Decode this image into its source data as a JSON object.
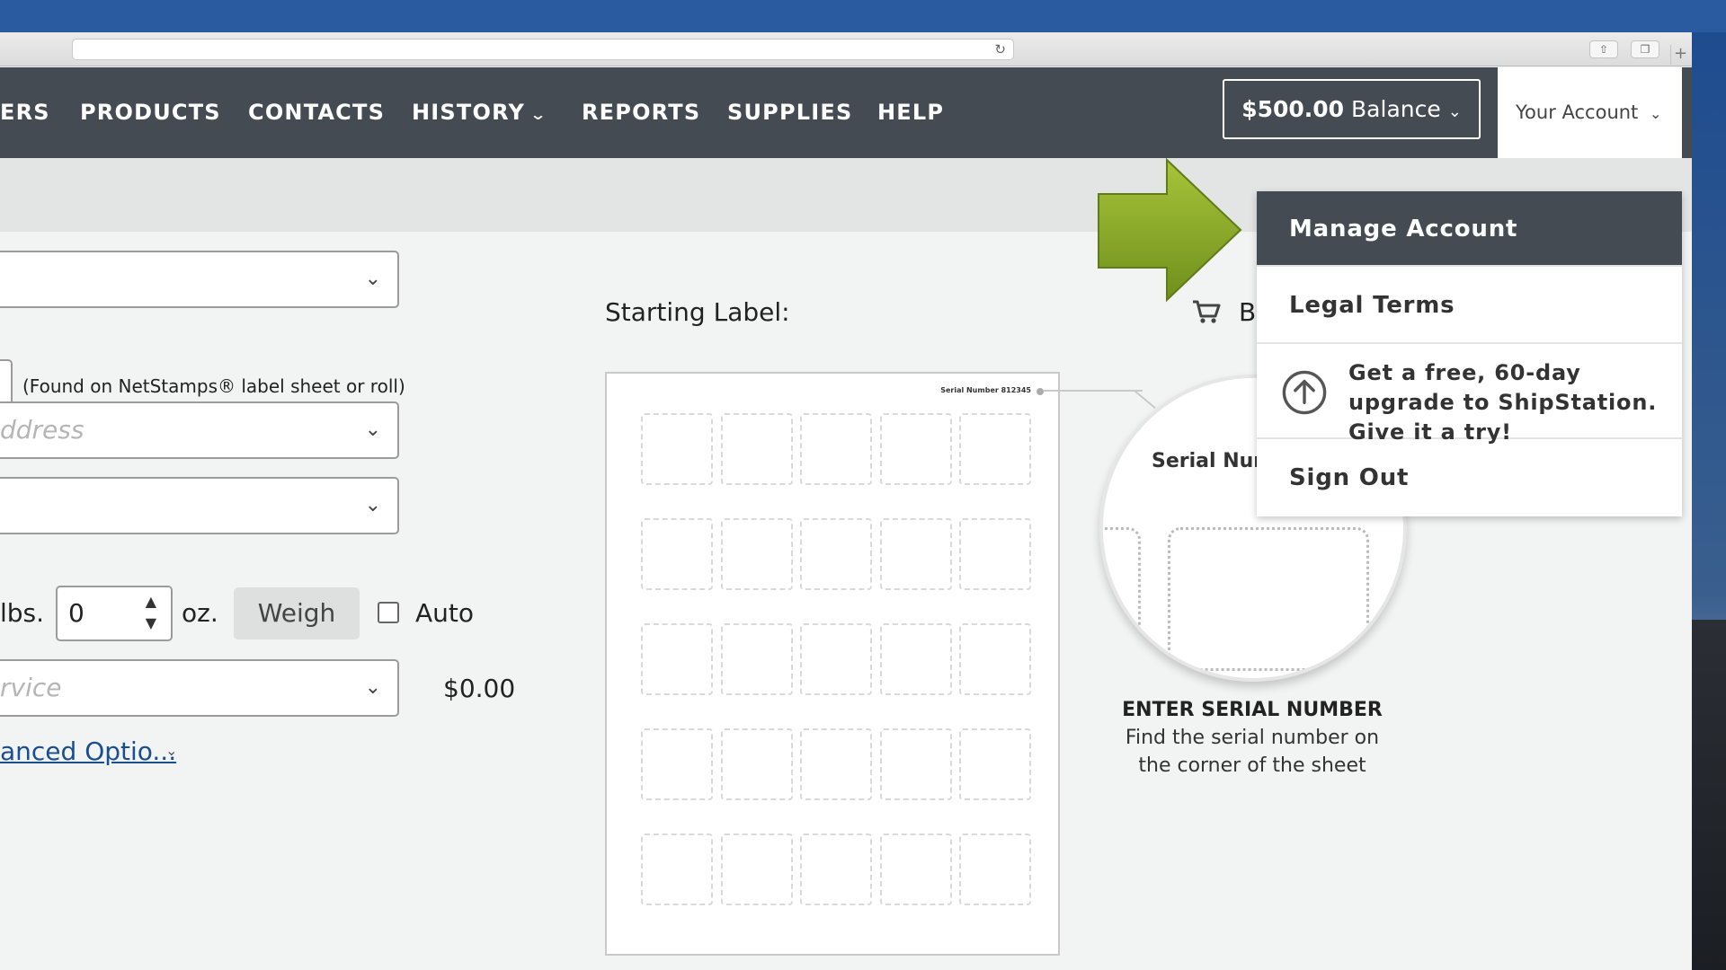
{
  "nav": {
    "items": [
      {
        "label": "ERS"
      },
      {
        "label": "PRODUCTS"
      },
      {
        "label": "CONTACTS"
      },
      {
        "label": "HISTORY"
      },
      {
        "label": "REPORTS"
      },
      {
        "label": "SUPPLIES"
      },
      {
        "label": "HELP"
      }
    ],
    "balance_amount": "$500.00",
    "balance_label": "Balance",
    "account_label": "Your Account"
  },
  "form": {
    "serial_hint": "(Found on NetStamps® label sheet or roll)",
    "address_placeholder": "ddress",
    "lbs_label": "lbs.",
    "oz_value": "0",
    "oz_label": "oz.",
    "weigh_label": "Weigh",
    "auto_label": "Auto",
    "service_placeholder": "rvice",
    "price": "$0.00",
    "advanced_label": "anced Optio..."
  },
  "labels": {
    "starting_label": "Starting Label:",
    "sheet_serial": "Serial Number 812345",
    "magnifier_title": "Serial Numb",
    "enter_serial": "ENTER SERIAL NUMBER",
    "find_serial_line1": "Find the serial number on",
    "find_serial_line2": "the corner of the sheet",
    "buy_partial": "B"
  },
  "dropdown": {
    "manage": "Manage Account",
    "legal": "Legal Terms",
    "upgrade": "Get a free, 60-day upgrade to ShipStation. Give it a try!",
    "signout": "Sign Out"
  },
  "colors": {
    "navbar": "#454b52",
    "accent_arrow": "#8fae2b",
    "link": "#1a4f8f"
  }
}
